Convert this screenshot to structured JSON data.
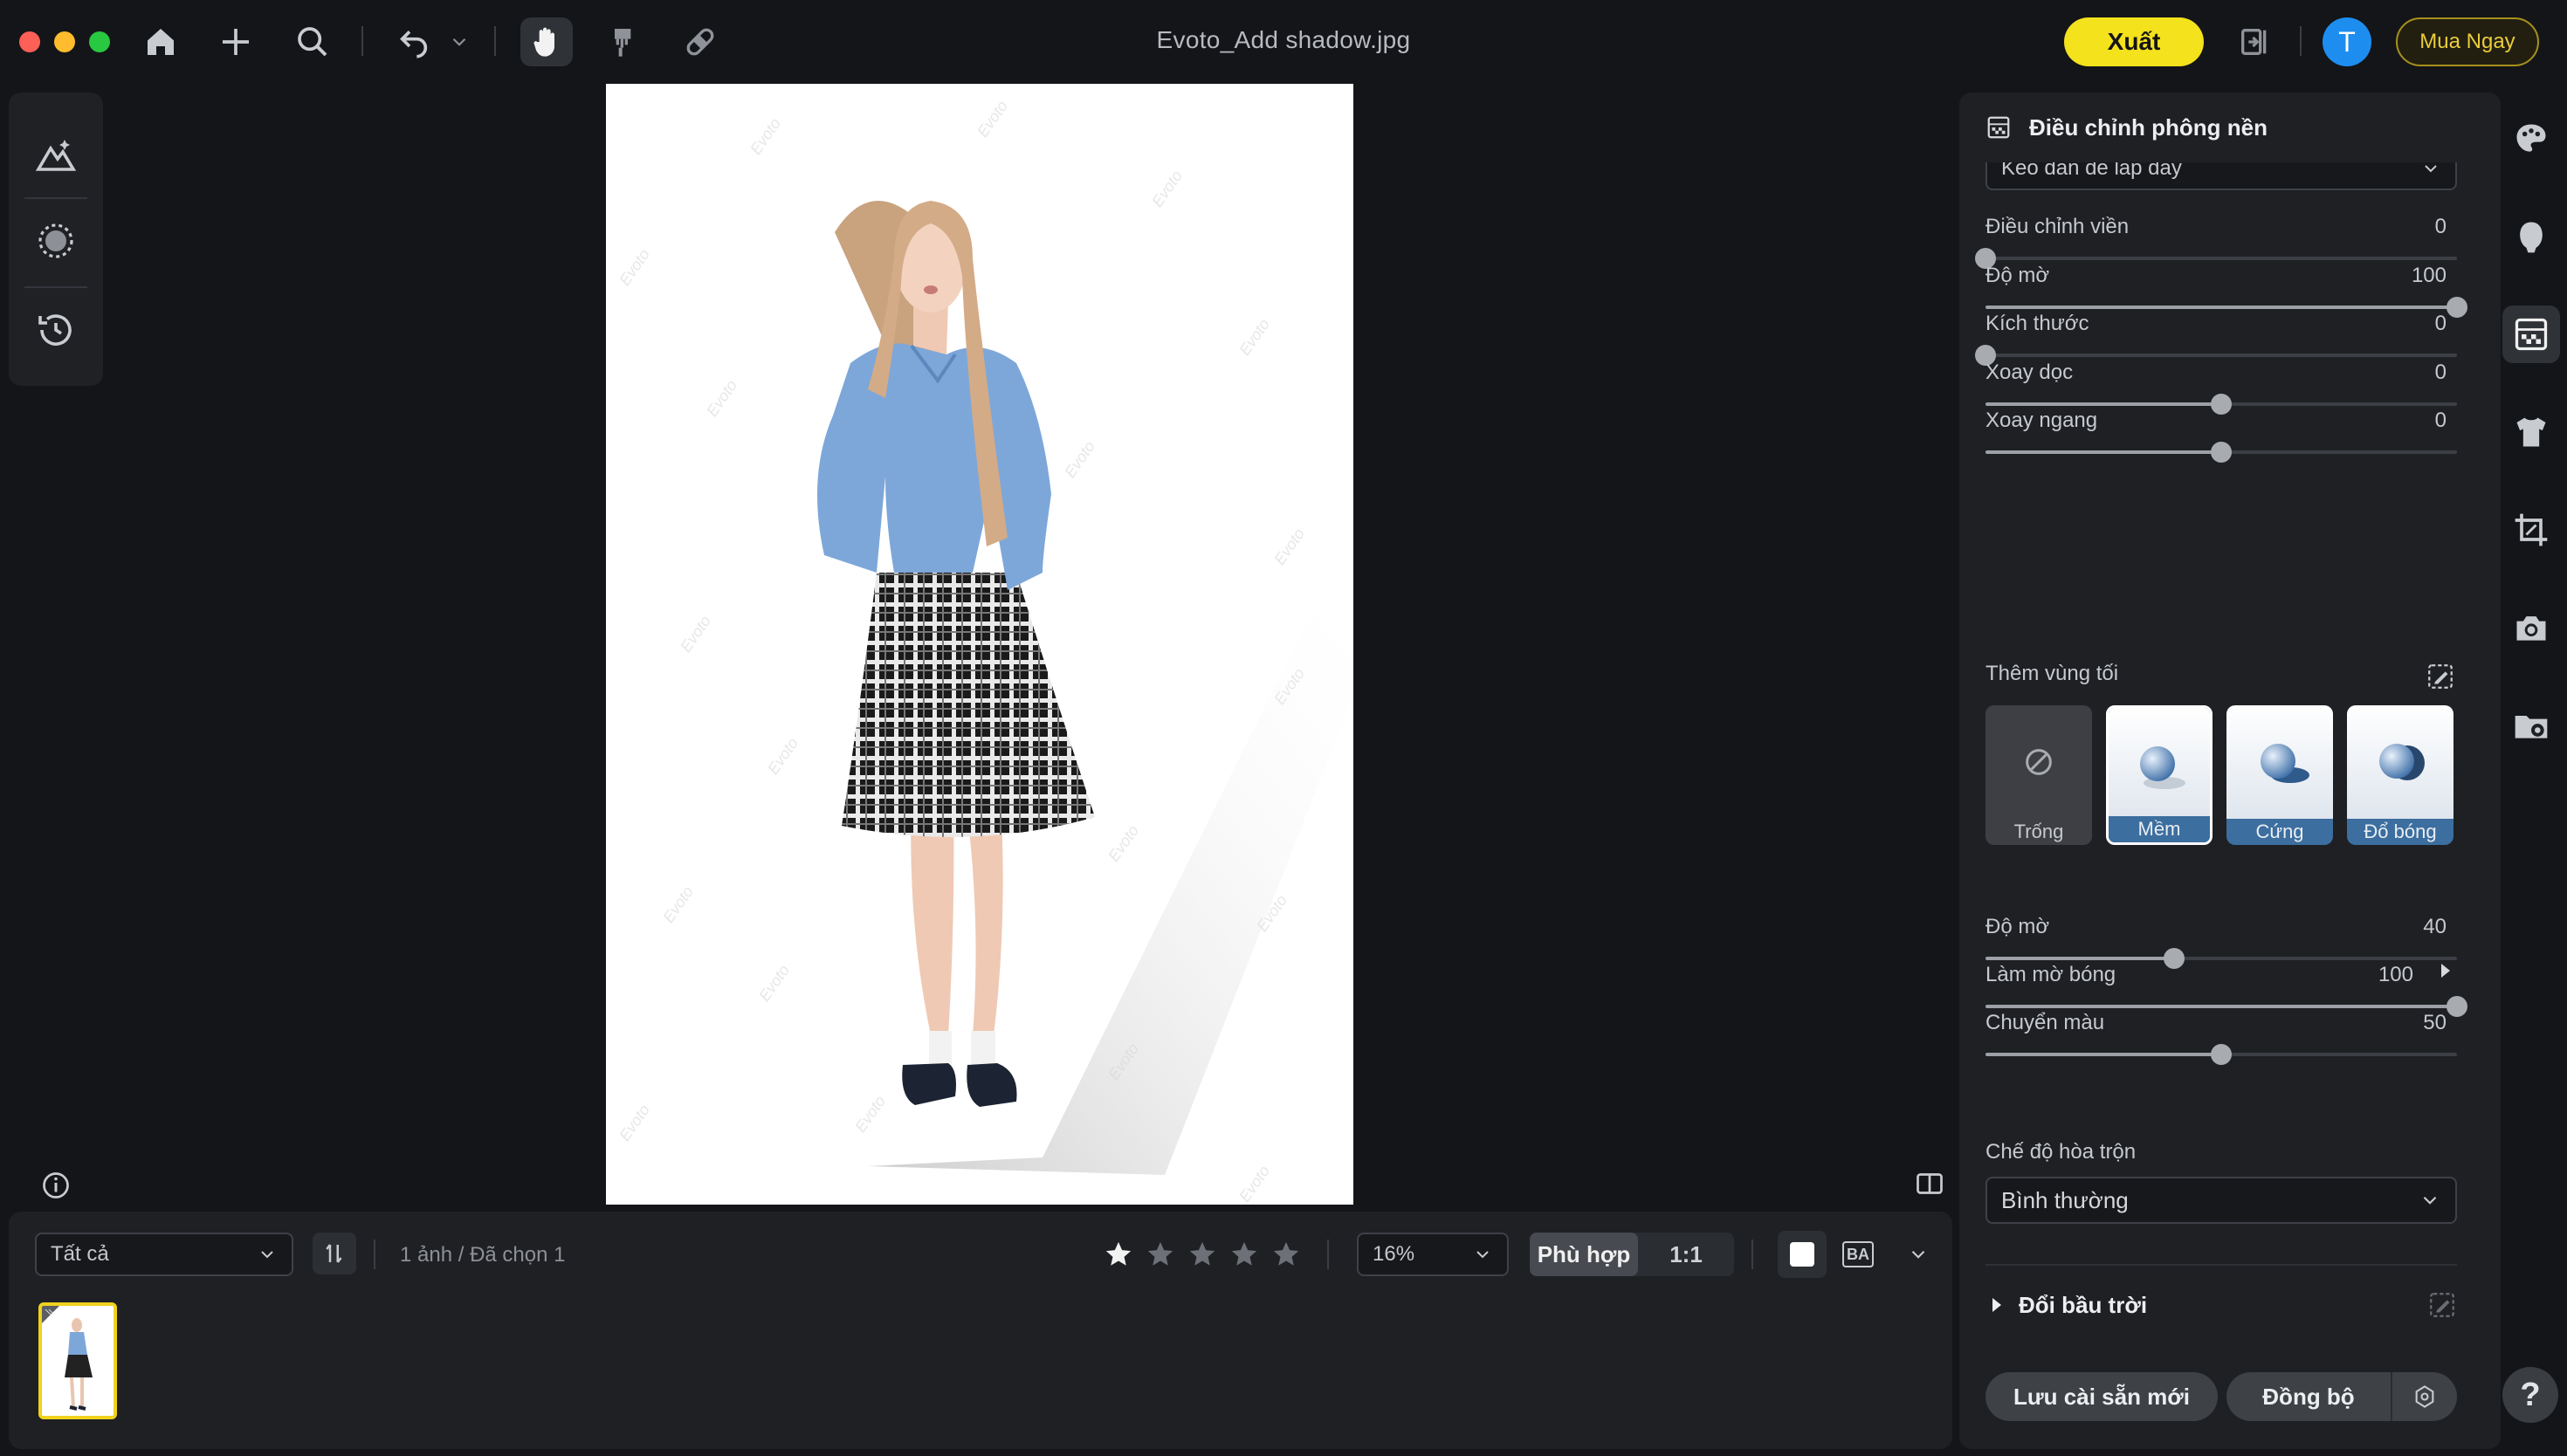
{
  "titlebar": {
    "document_title": "Evoto_Add shadow.jpg",
    "export_label": "Xuất",
    "avatar_initial": "T",
    "buy_label": "Mua Ngay"
  },
  "bottom": {
    "filter_value": "Tất cả",
    "count_label": "1 ảnh / Đã chọn 1",
    "rating": {
      "selected": 1,
      "max": 5
    },
    "zoom_value": "16%",
    "fit_label": "Phù hợp",
    "one_to_one_label": "1:1",
    "before_after_label": "BA"
  },
  "panel": {
    "title": "Điều chỉnh phông nền",
    "cut_select_value": "Kéo dán để lấp đầy",
    "sliders_top": [
      {
        "label": "Điều chỉnh viền",
        "value": "0",
        "fraction": 0.0
      },
      {
        "label": "Độ mờ",
        "value": "100",
        "fraction": 1.0
      },
      {
        "label": "Kích thước",
        "value": "0",
        "fraction": 0.0
      },
      {
        "label": "Xoay dọc",
        "value": "0",
        "fraction": 0.5
      },
      {
        "label": "Xoay ngang",
        "value": "0",
        "fraction": 0.5
      }
    ],
    "shadow_label": "Thêm vùng tối",
    "shadow_options": [
      {
        "label": "Trống",
        "selected": false
      },
      {
        "label": "Mềm",
        "selected": true
      },
      {
        "label": "Cứng",
        "selected": false
      },
      {
        "label": "Đổ bóng",
        "selected": false
      }
    ],
    "sliders_bottom": [
      {
        "label": "Độ mờ",
        "value": "40",
        "fraction": 0.4
      },
      {
        "label": "Làm mờ bóng",
        "value": "100",
        "fraction": 1.0
      },
      {
        "label": "Chuyển màu",
        "value": "50",
        "fraction": 0.5
      }
    ],
    "blend_label": "Chế độ hòa trộn",
    "blend_value": "Bình thường",
    "sky_label": "Đổi bầu trời",
    "save_preset_label": "Lưu cài sẵn mới",
    "sync_label": "Đồng bộ"
  },
  "canvas": {
    "watermark_text": "Evoto"
  },
  "colors": {
    "accent_yellow": "#f4e21c",
    "avatar_blue": "#1d8ef0",
    "selection_blue": "#3c6e9f"
  }
}
